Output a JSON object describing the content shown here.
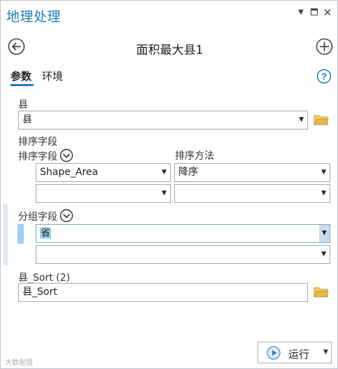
{
  "window": {
    "title": "地理处理",
    "menu_glyph": "▼",
    "close_glyph": "✕"
  },
  "tool": {
    "title": "面积最大县1"
  },
  "tabs": {
    "parameters": "参数",
    "environments": "环境"
  },
  "params": {
    "county": {
      "label": "县",
      "value": "县"
    },
    "sort_fields": {
      "group_label": "排序字段",
      "field_col_label": "排序字段",
      "method_col_label": "排序方法",
      "rows": [
        {
          "field": "Shape_Area",
          "method": "降序"
        },
        {
          "field": "",
          "method": ""
        }
      ]
    },
    "group_fields": {
      "label": "分组字段",
      "rows": [
        {
          "value": "省"
        },
        {
          "value": ""
        }
      ]
    },
    "output": {
      "label": "县_Sort (2)",
      "value": "县_Sort"
    }
  },
  "footer": {
    "run_label": "运行"
  },
  "watermark": {
    "text": "大数据猎"
  },
  "colors": {
    "accent": "#1c7fbd",
    "folder": "#e8b84a",
    "selection": "#9fd0f2"
  }
}
